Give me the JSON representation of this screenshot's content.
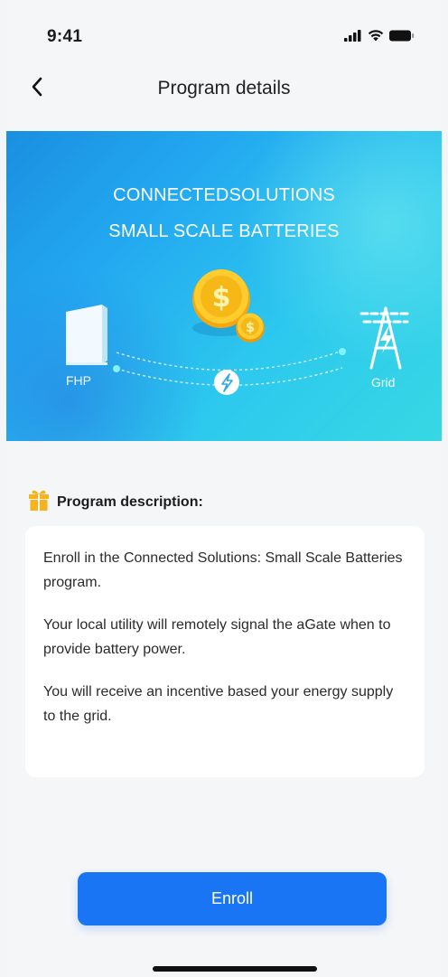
{
  "status_bar": {
    "time": "9:41"
  },
  "nav": {
    "title": "Program details"
  },
  "banner": {
    "title_line1": "CONNECTEDSOLUTIONS",
    "title_line2": "SMALL SCALE BATTERIES",
    "left_label": "FHP",
    "right_label": "Grid"
  },
  "description": {
    "heading": "Program description:",
    "paragraphs": [
      "Enroll in the Connected Solutions: Small Scale Batteries program.",
      "Your local utility will remotely signal the aGate when to provide battery power.",
      "You will receive an incentive based your energy supply to the grid."
    ]
  },
  "actions": {
    "enroll_label": "Enroll"
  },
  "colors": {
    "accent": "#1a75f5",
    "banner_start": "#1a8fe0",
    "banner_end": "#37d8e3",
    "gift": "#f5b31c"
  }
}
